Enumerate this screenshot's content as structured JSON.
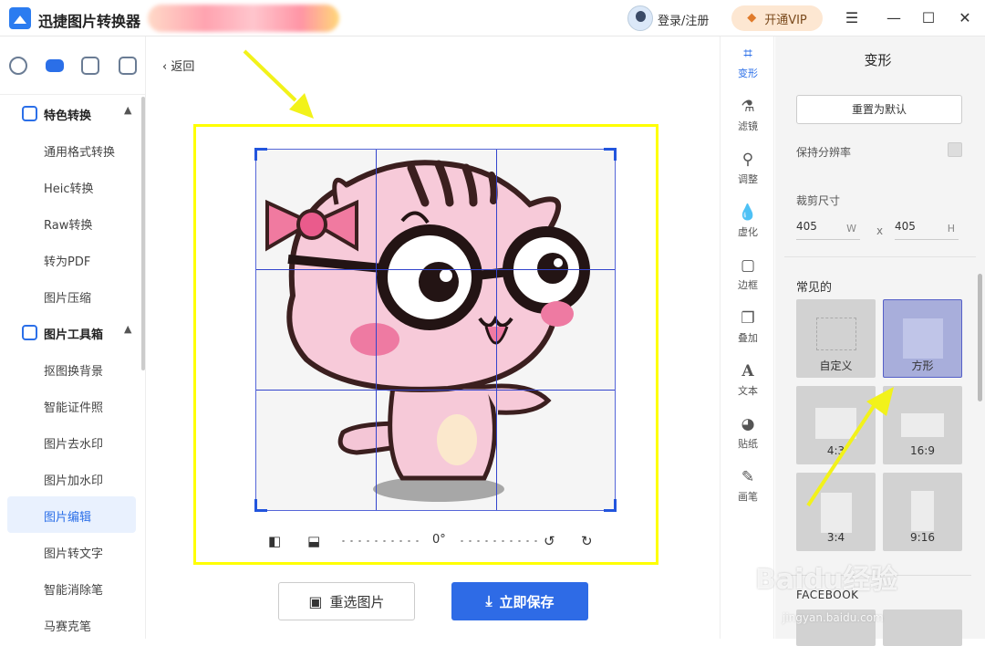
{
  "app": {
    "title": "迅捷图片转换器"
  },
  "header": {
    "login_label": "登录/注册",
    "vip_label": "开通VIP"
  },
  "sidebar": {
    "groups": [
      {
        "label": "特色转换",
        "items": [
          "通用格式转换",
          "Heic转换",
          "Raw转换",
          "转为PDF",
          "图片压缩"
        ]
      },
      {
        "label": "图片工具箱",
        "items": [
          "抠图换背景",
          "智能证件照",
          "图片去水印",
          "图片加水印",
          "图片编辑",
          "图片转文字",
          "智能消除笔",
          "马赛克笔"
        ]
      }
    ],
    "active_item": "图片编辑"
  },
  "canvas": {
    "back_label": "返回",
    "rotation_label": "0°",
    "reselect_label": "重选图片",
    "save_label": "立即保存"
  },
  "tools": [
    {
      "label": "变形",
      "icon": "crop-icon"
    },
    {
      "label": "滤镜",
      "icon": "filter-icon"
    },
    {
      "label": "调整",
      "icon": "adjust-icon"
    },
    {
      "label": "虚化",
      "icon": "blur-icon"
    },
    {
      "label": "边框",
      "icon": "border-icon"
    },
    {
      "label": "叠加",
      "icon": "overlay-icon"
    },
    {
      "label": "文本",
      "icon": "text-icon"
    },
    {
      "label": "贴纸",
      "icon": "sticker-icon"
    },
    {
      "label": "画笔",
      "icon": "brush-icon"
    }
  ],
  "panel": {
    "title": "变形",
    "reset_label": "重置为默认",
    "keep_resolution_label": "保持分辨率",
    "crop_size_label": "裁剪尺寸",
    "width_value": "405",
    "width_unit": "W",
    "height_value": "405",
    "height_unit": "H",
    "times_label": "x",
    "common_label": "常见的",
    "presets": [
      "自定义",
      "方形",
      "4:3",
      "16:9",
      "3:4",
      "9:16"
    ],
    "selected_preset": "方形",
    "facebook_label": "FACEBOOK"
  },
  "watermark": {
    "text": "Baidu经验",
    "sub": "jingyan.baidu.com"
  },
  "colors": {
    "accent": "#2b6fe8",
    "highlight_frame": "#ffff00",
    "annotation_arrow": "#f2f21a"
  }
}
